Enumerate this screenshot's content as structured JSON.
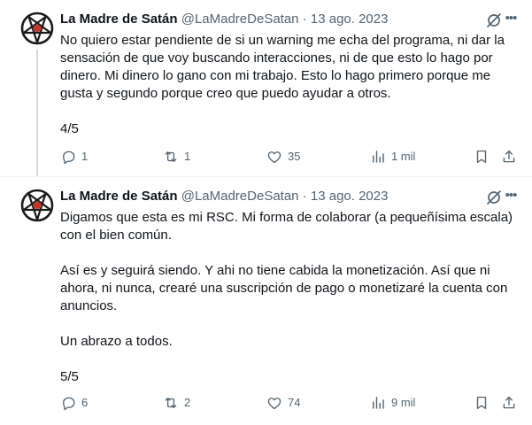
{
  "tweets": [
    {
      "author_name": "La Madre de Satán",
      "handle": "@LaMadreDeSatan",
      "separator": "·",
      "date": "13 ago. 2023",
      "paragraphs": [
        "No quiero estar pendiente de si un warning me echa del programa, ni dar la sensación de que voy buscando interacciones, ni de que esto lo hago por dinero. Mi dinero lo gano con mi trabajo. Esto lo hago primero porque me gusta y segundo porque creo que puedo ayudar a otros.",
        "4/5"
      ],
      "replies": "1",
      "retweets": "1",
      "likes": "35",
      "views": "1 mil",
      "more_label": "•••"
    },
    {
      "author_name": "La Madre de Satán",
      "handle": "@LaMadreDeSatan",
      "separator": "·",
      "date": "13 ago. 2023",
      "paragraphs": [
        "Digamos que esta es mi RSC. Mi forma de colaborar (a pequeñísima escala) con el bien común.",
        "Así es y seguirá siendo. Y ahi no tiene cabida la monetización. Así que ni ahora, ni nunca, crearé una suscripción de pago o monetizaré la cuenta con anuncios.",
        "Un abrazo a todos.",
        "5/5"
      ],
      "replies": "6",
      "retweets": "2",
      "likes": "74",
      "views": "9 mil",
      "more_label": "•••"
    }
  ],
  "icons": {
    "avatar": "pentagram-avatar-icon",
    "grok": "grok-icon",
    "more": "more-icon",
    "reply": "reply-icon",
    "retweet": "retweet-icon",
    "like": "heart-icon",
    "views": "views-icon",
    "bookmark": "bookmark-icon",
    "share": "share-icon"
  },
  "colors": {
    "text": "#0f1419",
    "secondary": "#536471",
    "thread_line": "#cfd9de",
    "avatar_red": "#b3261e"
  }
}
